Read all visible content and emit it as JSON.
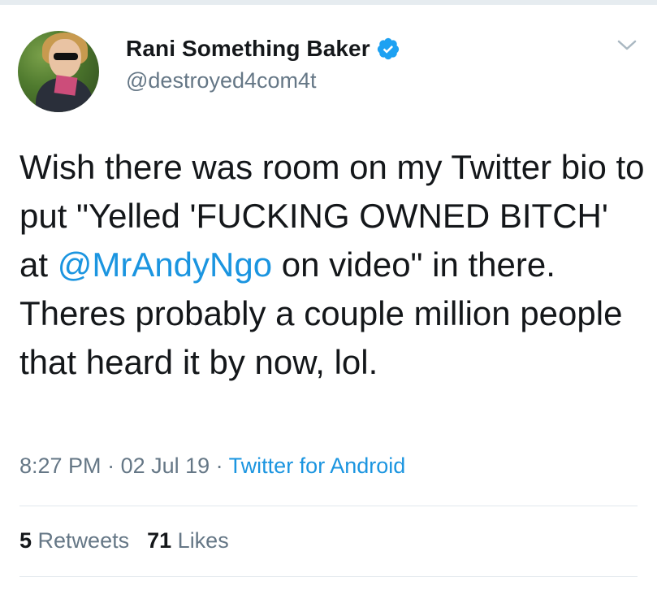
{
  "tweet": {
    "author": {
      "display_name": "Rani Something Baker",
      "handle": "@destroyed4com4t",
      "verified": true,
      "verified_color": "#1da1f2"
    },
    "text_parts": {
      "before_mention": "Wish there was room on my Twitter bio to put \"Yelled 'FUCKING OWNED BITCH' at ",
      "mention": "@MrAndyNgo",
      "after_mention": " on video\" in there. Theres probably a couple million people that heard it by now, lol."
    },
    "meta": {
      "time": "8:27 PM",
      "separator": " · ",
      "date": "02 Jul 19",
      "source": "Twitter for Android"
    },
    "stats": {
      "retweets_count": "5",
      "retweets_label": "Retweets",
      "likes_count": "71",
      "likes_label": "Likes"
    }
  },
  "icons": {
    "menu": "chevron-down-icon",
    "verified": "verified-badge-icon"
  },
  "colors": {
    "link": "#1b95e0",
    "secondary_text": "#657786",
    "primary_text": "#14171a"
  }
}
